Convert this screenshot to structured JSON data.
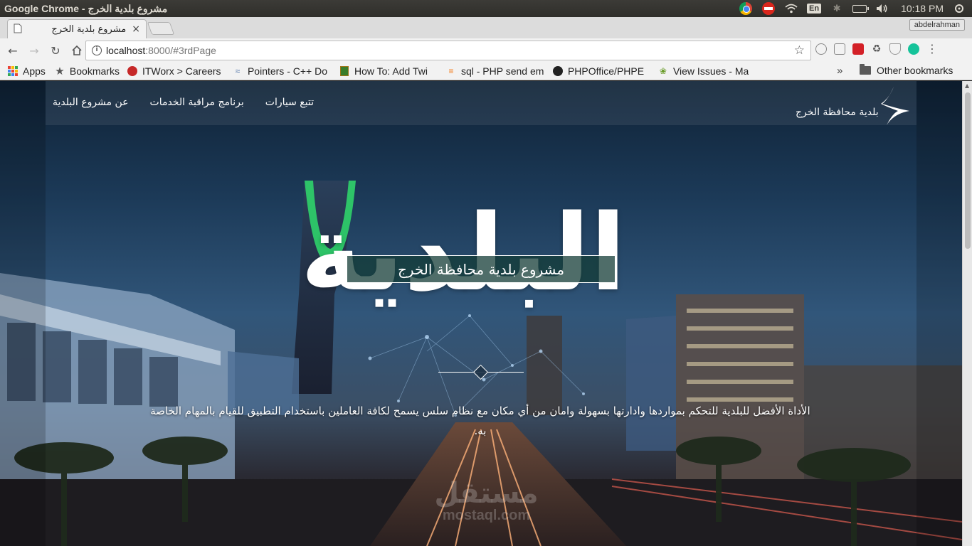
{
  "os": {
    "window_title": "Google Chrome - مشروع بلدية الخرج",
    "language": "En",
    "time": "10:18 PM"
  },
  "browser": {
    "tab_title": "مشروع بلدية الخرج",
    "tab_close": "×",
    "profile": "abdelrahman",
    "url_host": "localhost",
    "url_rest": ":8000/#3rdPage",
    "bookmarks": [
      {
        "label": "Apps",
        "icon": "apps-grid-icon"
      },
      {
        "label": "Bookmarks",
        "icon": "star-icon"
      },
      {
        "label": "ITWorx > Careers",
        "icon": "itworx-icon"
      },
      {
        "label": "Pointers - C++ Do",
        "icon": "cplusplus-icon"
      },
      {
        "label": "How To: Add Twi",
        "icon": "howto-icon"
      },
      {
        "label": "sql - PHP send em",
        "icon": "stackoverflow-icon"
      },
      {
        "label": "PHPOffice/PHPE",
        "icon": "github-icon"
      },
      {
        "label": "View Issues - Ma",
        "icon": "mantis-icon"
      }
    ],
    "bookmarks_more": "»",
    "other_bookmarks": "Other bookmarks"
  },
  "site": {
    "logo_text": "بلدية محافظة الخرج",
    "nav": [
      {
        "label": "عن مشروع البلدية"
      },
      {
        "label": "برنامج مراقبة الخدمات"
      },
      {
        "label": "تتبع سيارات"
      }
    ],
    "hero_big_word": "البلدية",
    "hero_title": "مشروع بلدية محافظة الخرج",
    "hero_description": "الأداة الأفضل للبلدية للتحكم بمواردها وادارتها بسهولة وامان من أي مكان مع نظام سلس يسمح لكافة العاملين باستخدام التطبيق للقيام بالمهام الخاصة به.",
    "watermark_ar": "مستقل",
    "watermark_en": "mostaql.com"
  },
  "colors": {
    "title_box_bg": "#143c37",
    "accent_green": "#2fd36a"
  }
}
